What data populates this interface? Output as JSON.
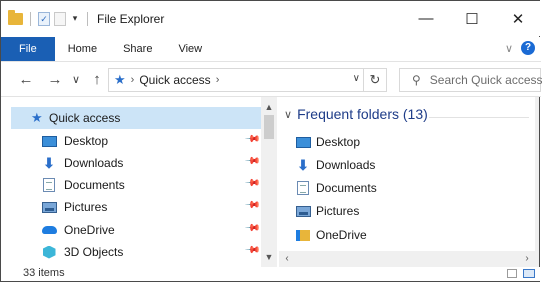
{
  "window": {
    "title": "File Explorer"
  },
  "ribbon": {
    "tabs": [
      "File",
      "Home",
      "Share",
      "View"
    ]
  },
  "nav": {
    "address": "Quick access",
    "search_placeholder": "Search Quick access"
  },
  "sidebar": {
    "header": "Quick access",
    "items": [
      {
        "label": "Desktop",
        "icon": "desktop-icon",
        "pinned": true
      },
      {
        "label": "Downloads",
        "icon": "downloads-icon",
        "pinned": true
      },
      {
        "label": "Documents",
        "icon": "documents-icon",
        "pinned": true
      },
      {
        "label": "Pictures",
        "icon": "pictures-icon",
        "pinned": true
      },
      {
        "label": "OneDrive",
        "icon": "onedrive-icon",
        "pinned": true
      },
      {
        "label": "3D Objects",
        "icon": "3d-objects-icon",
        "pinned": true
      }
    ]
  },
  "main": {
    "section_title": "Frequent folders (13)",
    "folders": [
      {
        "label": "Desktop",
        "icon": "desktop-icon"
      },
      {
        "label": "Downloads",
        "icon": "downloads-icon"
      },
      {
        "label": "Documents",
        "icon": "documents-icon"
      },
      {
        "label": "Pictures",
        "icon": "pictures-icon"
      },
      {
        "label": "OneDrive",
        "icon": "onedrive-icon"
      }
    ]
  },
  "status": {
    "item_count": "33 items"
  },
  "colors": {
    "accent": "#1a5fb4",
    "selection": "#cce4f7",
    "heading": "#1e3c88"
  }
}
